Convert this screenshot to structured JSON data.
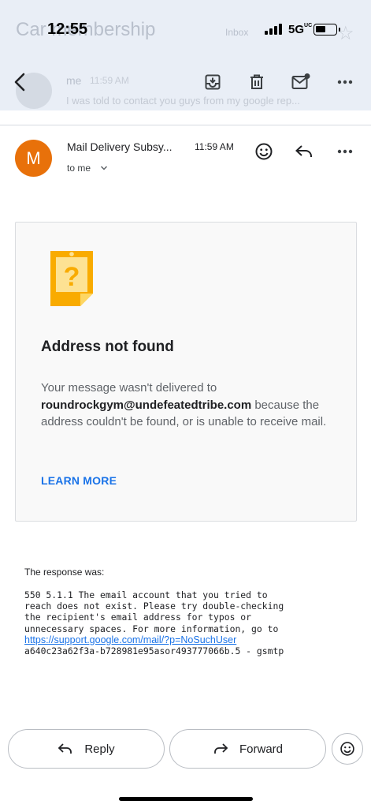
{
  "status_bar": {
    "time": "12:55",
    "network": "5G",
    "network_suffix": "UC"
  },
  "background_list": {
    "subject": "Car membership",
    "label": "Inbox",
    "sender": "me",
    "time": "11:59 AM",
    "snippet": "I was told to contact you guys from my google rep..."
  },
  "toolbar": {
    "back_icon": "arrow-left-icon",
    "archive_icon": "move-to-inbox-icon",
    "delete_icon": "trash-icon",
    "unread_icon": "mark-unread-icon",
    "more_icon": "more-vert-icon"
  },
  "message": {
    "avatar_letter": "M",
    "avatar_color": "#e8710a",
    "sender": "Mail Delivery Subsy...",
    "time": "11:59 AM",
    "recipient": "to me"
  },
  "card": {
    "title": "Address not found",
    "body_prefix": "Your message wasn't delivered to",
    "address": "roundrockgym@undefeatedtribe.com",
    "body_suffix": "because the address couldn't be found, or is unable to receive mail.",
    "learn_more": "LEARN MORE",
    "accent_color": "#f9ab00"
  },
  "response": {
    "label": "The response was:",
    "lines": [
      "550 5.1.1 The email account that you tried to",
      "reach does not exist. Please try double-checking",
      "the recipient's email address for typos or",
      "unnecessary spaces. For more information, go to"
    ],
    "link": "https://support.google.com/mail/?p=NoSuchUser",
    "trailer": "a640c23a62f3a-b728981e95asor493777066b.5 - gsmtp"
  },
  "actions": {
    "reply": "Reply",
    "forward": "Forward"
  }
}
